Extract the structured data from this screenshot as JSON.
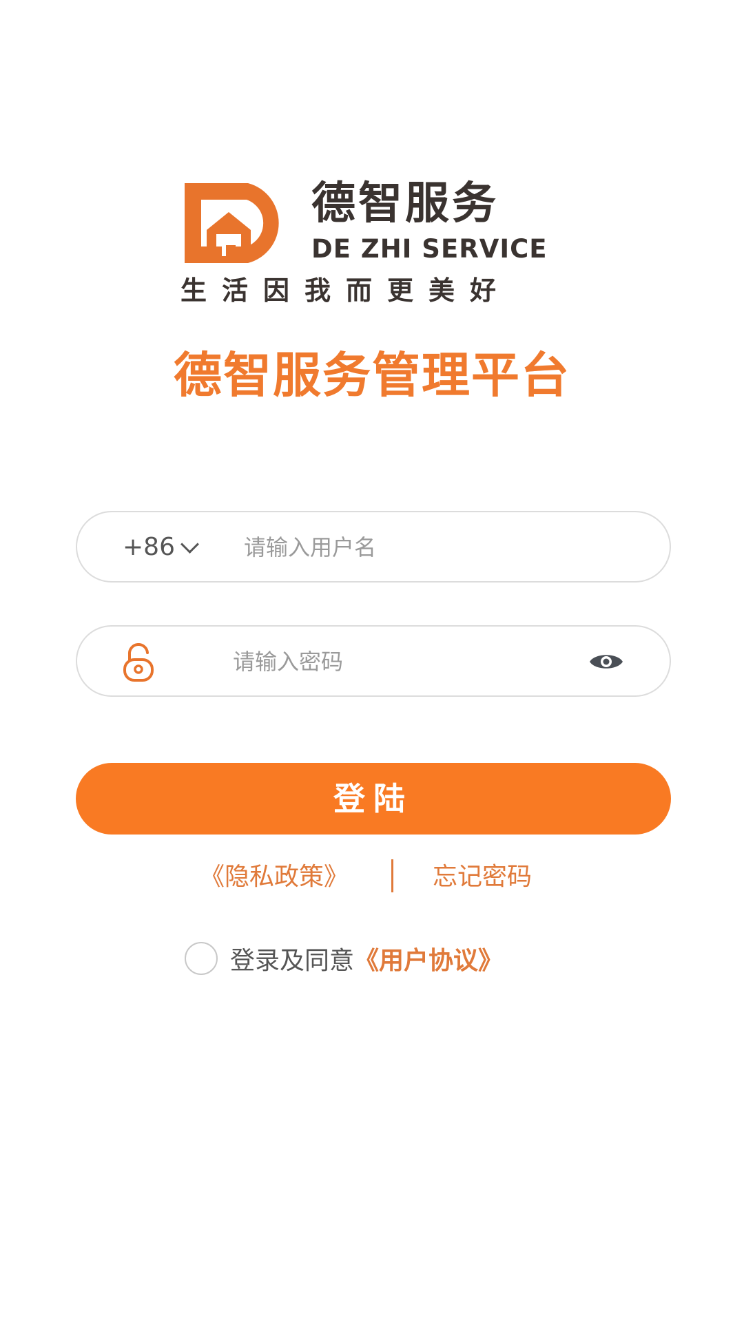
{
  "brand": {
    "name_cn": "德智服务",
    "name_en": "DE ZHI SERVICE",
    "slogan": "生活因我而更美好",
    "logo_icon": "house-d-logo-icon",
    "logo_color": "#e8742c"
  },
  "title": "德智服务管理平台",
  "username_field": {
    "country_code": "+86",
    "placeholder": "请输入用户名",
    "value": ""
  },
  "password_field": {
    "placeholder": "请输入密码",
    "value": "",
    "lock_icon": "lock-icon",
    "toggle_icon": "eye-icon"
  },
  "login_button": {
    "label": "登陆"
  },
  "links": {
    "privacy": "《隐私政策》",
    "forgot": "忘记密码"
  },
  "agreement": {
    "checked": false,
    "text": "登录及同意",
    "link": "《用户协议》"
  },
  "colors": {
    "accent": "#f97a23",
    "link": "#e07a3a",
    "text": "#3a3330"
  }
}
